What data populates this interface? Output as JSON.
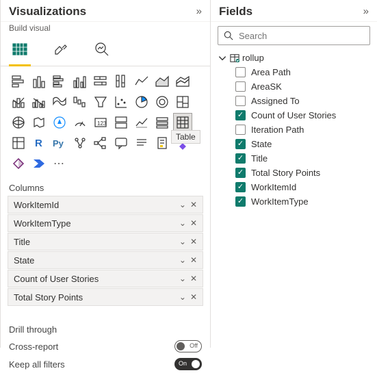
{
  "visualizations": {
    "title": "Visualizations",
    "subtitle": "Build visual",
    "tooltip": "Table",
    "columns_label": "Columns",
    "columns": [
      "WorkItemId",
      "WorkItemType",
      "Title",
      "State",
      "Count of User Stories",
      "Total Story Points"
    ],
    "drill_through_label": "Drill through",
    "cross_report_label": "Cross-report",
    "cross_report_state": "Off",
    "keep_filters_label": "Keep all filters",
    "keep_filters_state": "On"
  },
  "fields": {
    "title": "Fields",
    "search_placeholder": "Search",
    "table_name": "rollup",
    "items": [
      {
        "label": "Area Path",
        "checked": false
      },
      {
        "label": "AreaSK",
        "checked": false
      },
      {
        "label": "Assigned To",
        "checked": false
      },
      {
        "label": "Count of User Stories",
        "checked": true
      },
      {
        "label": "Iteration Path",
        "checked": false
      },
      {
        "label": "State",
        "checked": true
      },
      {
        "label": "Title",
        "checked": true
      },
      {
        "label": "Total Story Points",
        "checked": true
      },
      {
        "label": "WorkItemId",
        "checked": true
      },
      {
        "label": "WorkItemType",
        "checked": true
      }
    ]
  },
  "viz_icons": [
    "stacked-bar",
    "stacked-column",
    "clustered-bar",
    "clustered-column",
    "100-stacked-bar",
    "100-stacked-column",
    "line",
    "area",
    "stacked-area",
    "line-stacked-column",
    "line-clustered-column",
    "ribbon",
    "waterfall",
    "funnel",
    "scatter",
    "pie",
    "donut",
    "treemap",
    "map",
    "filled-map",
    "azure-map",
    "gauge",
    "card",
    "multi-row-card",
    "kpi",
    "slicer",
    "table",
    "matrix",
    "r-visual",
    "py-visual",
    "key-influencers",
    "decomposition-tree",
    "qa",
    "narrative",
    "paginated",
    "arcgis",
    "power-apps",
    "power-automate",
    "more"
  ]
}
